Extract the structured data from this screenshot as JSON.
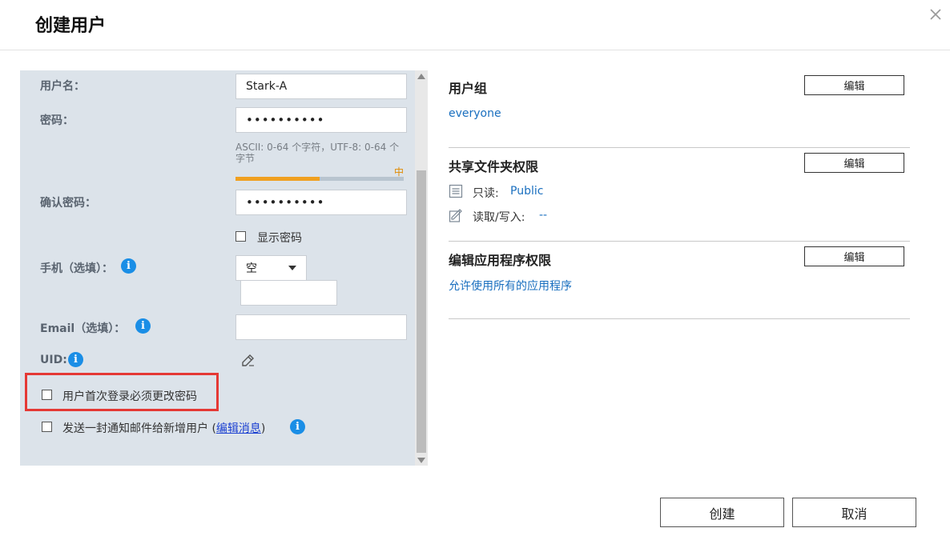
{
  "dialog": {
    "title": "创建用户",
    "close_icon": "close-icon"
  },
  "form": {
    "username": {
      "label": "用户名：",
      "value": "Stark-A"
    },
    "password": {
      "label": "密码：",
      "value": "••••••••••",
      "hint": "ASCII: 0-64 个字符，UTF-8: 0-64 个字节",
      "strength_label": "中",
      "strength_fraction": 0.5
    },
    "confirm_password": {
      "label": "确认密码：",
      "value": "••••••••••"
    },
    "show_password": {
      "label": "显示密码"
    },
    "phone": {
      "label": "手机（选填）：",
      "country_value": "空",
      "number_value": ""
    },
    "email": {
      "label": "Email（选填）：",
      "value": ""
    },
    "uid": {
      "label": "UID:"
    },
    "force_change": {
      "label": "用户首次登录必须更改密码"
    },
    "notify": {
      "label": "发送一封通知邮件给新增用户 (",
      "link": "编辑消息",
      "suffix": ")"
    }
  },
  "right": {
    "groups": {
      "title": "用户组",
      "edit_label": "编辑",
      "value": "everyone"
    },
    "shared": {
      "title": "共享文件夹权限",
      "edit_label": "编辑",
      "readonly_label": "只读:",
      "readonly_value": "Public",
      "readwrite_label": "读取/写入:",
      "readwrite_value": "--"
    },
    "apps": {
      "title": "编辑应用程序权限",
      "edit_label": "编辑",
      "value": "允许使用所有的应用程序"
    }
  },
  "footer": {
    "create_label": "创建",
    "cancel_label": "取消"
  },
  "colors": {
    "accent": "#1a8ee6",
    "highlight": "#e53935",
    "strength": "#f0a020",
    "panel": "#dce3ea"
  }
}
